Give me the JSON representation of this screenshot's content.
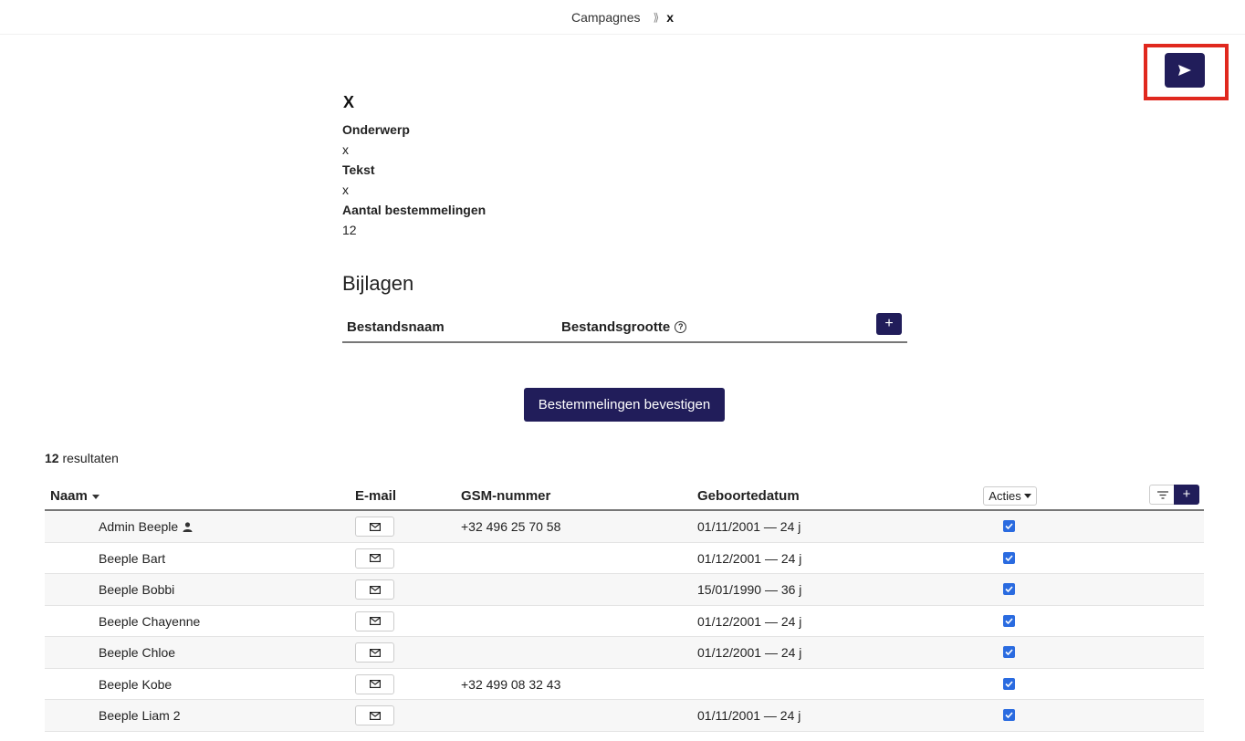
{
  "breadcrumb": {
    "root": "Campagnes",
    "separator": "⟫",
    "current": "x"
  },
  "detail": {
    "title": "X",
    "fields": [
      {
        "label": "Onderwerp",
        "value": "x"
      },
      {
        "label": "Tekst",
        "value": "x"
      },
      {
        "label": "Aantal bestemmelingen",
        "value": "12"
      }
    ]
  },
  "attachments": {
    "heading": "Bijlagen",
    "col_filename": "Bestandsnaam",
    "col_filesize": "Bestandsgrootte",
    "add_label": "+"
  },
  "confirm_button": "Bestemmelingen bevestigen",
  "results": {
    "count": "12",
    "label": "resultaten"
  },
  "table": {
    "columns": {
      "name": "Naam",
      "email": "E-mail",
      "gsm": "GSM-nummer",
      "birth": "Geboortedatum"
    },
    "actions_label": "Acties",
    "add_label": "+",
    "rows": [
      {
        "name": "Admin Beeple",
        "admin": true,
        "gsm": "+32 496 25 70 58",
        "birth": "01/11/2001 — 24 j",
        "checked": true
      },
      {
        "name": "Beeple Bart",
        "gsm": "",
        "birth": "01/12/2001 — 24 j",
        "checked": true
      },
      {
        "name": "Beeple Bobbi",
        "gsm": "",
        "birth": "15/01/1990 — 36 j",
        "checked": true
      },
      {
        "name": "Beeple Chayenne",
        "gsm": "",
        "birth": "01/12/2001 — 24 j",
        "checked": true
      },
      {
        "name": "Beeple Chloe",
        "gsm": "",
        "birth": "01/12/2001 — 24 j",
        "checked": true
      },
      {
        "name": "Beeple Kobe",
        "gsm": "+32 499 08 32 43",
        "birth": "",
        "checked": true
      },
      {
        "name": "Beeple Liam 2",
        "gsm": "",
        "birth": "01/11/2001 — 24 j",
        "checked": true
      }
    ]
  },
  "colors": {
    "primary": "#211d5a",
    "highlight": "#e0281e",
    "checkbox": "#2a6be0"
  },
  "icons": {
    "send": "send-icon",
    "mail": "mail-icon",
    "user": "user-icon",
    "help": "help-icon",
    "filter": "filter-icon"
  }
}
